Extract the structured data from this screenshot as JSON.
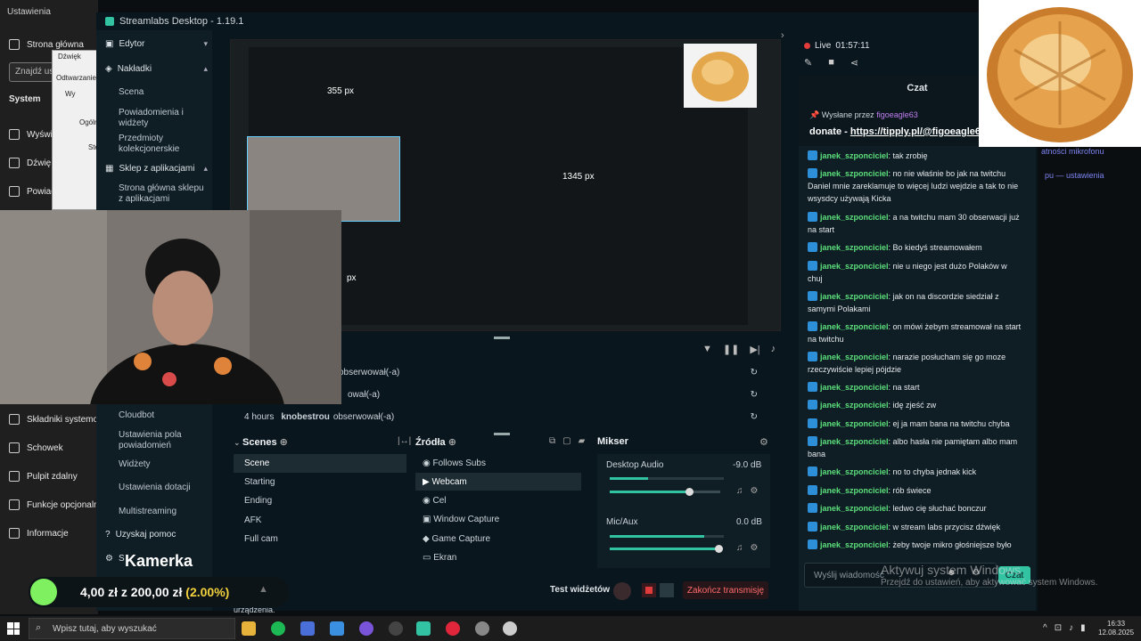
{
  "settings": {
    "title": "Ustawienia",
    "home": "Strona główna",
    "search_placeholder": "Znajdź ust",
    "system": "System",
    "display": "Wyświ",
    "sound": "Dźwię",
    "notifications": "Powiad",
    "components": "Składniki systemo",
    "clipboard": "Schowek",
    "remote": "Pulpit zdalny",
    "optional": "Funkcje opcjonalne",
    "info": "Informacje",
    "dialog_title": "Dźwięk",
    "dialog_tab": "Odtwarzanie",
    "dialog_item1": "Wy",
    "dialog_item2": "Ogóln",
    "dialog_item3": "Ste"
  },
  "window": {
    "title": "Streamlabs Desktop - 1.19.1"
  },
  "sidebar": {
    "editor": "Edytor",
    "overlays": "Nakładki",
    "scene": "Scena",
    "alerts": "Powiadomienia i widżety",
    "collectibles": "Przedmioty kolekcjonerskie",
    "app_store": "Sklep z aplikacjami",
    "store_home": "Strona główna sklepu z aplikacjami",
    "cloudbot": "Cloudbot",
    "alert_box": "Ustawienia pola powiadomień",
    "widgets": "Widżety",
    "donation_settings": "Ustawienia dotacji",
    "multistreaming": "Multistreaming",
    "help": "Uzyskaj pomoc",
    "s_prefix": "S"
  },
  "preview": {
    "label_355": "355 px",
    "label_1345": "1345 px",
    "label_px": "px"
  },
  "activity": [
    {
      "time": "",
      "user": "",
      "text": "obserwował(-a)"
    },
    {
      "time": "",
      "user": "",
      "text": "ował(-a)"
    },
    {
      "time": "4 hours",
      "user": "knobestrou",
      "text": "obserwował(-a)"
    }
  ],
  "scenes": {
    "title": "Scenes",
    "items": [
      "Scene",
      "Starting",
      "Ending",
      "AFK",
      "Full cam"
    ]
  },
  "sources": {
    "title": "Źródła",
    "items": [
      "Follows Subs",
      "Webcam",
      "Cel",
      "Window Capture",
      "Game Capture",
      "Ekran"
    ]
  },
  "mixer": {
    "title": "Mikser",
    "desktop_label": "Desktop Audio",
    "desktop_db": "-9.0 dB",
    "desktop_level": 0.72,
    "mic_label": "Mic/Aux",
    "mic_db": "0.0 dB",
    "mic_level": 0.98
  },
  "bottom": {
    "test_widgets": "Test widżetów",
    "end_stream": "Zakończ transmisję",
    "device_text": "urządzenia.",
    "kamerka": "Kamerka",
    "goal_amount": "4,00 zł z 200,00 zł",
    "goal_pct": "(2.00%)"
  },
  "live": {
    "label": "Live",
    "time": "01:57:11"
  },
  "chat": {
    "header": "Czat",
    "pinned_by": "Wysłane przez",
    "pinned_user": "figoeagle63",
    "pinned_prefix": "donate - ",
    "pinned_link": "https://tipply.pl/@figoeagle63",
    "input_placeholder": "Wyślij wiadomość",
    "send": "Czat",
    "messages": [
      {
        "u": "janek_szponciciel",
        "t": ": tak zrobię"
      },
      {
        "u": "janek_szponciciel",
        "t": ": no nie właśnie bo jak na twitchu Daniel mnie zareklamuje to więcej ludzi wejdzie a tak to nie wsysdcy używają Kicka"
      },
      {
        "u": "janek_szponciciel",
        "t": ": a na twitchu mam 30 obserwacji już na start"
      },
      {
        "u": "janek_szponciciel",
        "t": ": Bo kiedyś streamowałem"
      },
      {
        "u": "janek_szponciciel",
        "t": ": nie u niego jest dużo Polaków w chuj"
      },
      {
        "u": "janek_szponciciel",
        "t": ": jak on na discordzie siedział z samymi Polakami"
      },
      {
        "u": "janek_szponciciel",
        "t": ": on mówi żebym streamował na start na twitchu"
      },
      {
        "u": "janek_szponciciel",
        "t": ": narazie posłucham się go moze rzeczywiście lepiej pójdzie"
      },
      {
        "u": "janek_szponciciel",
        "t": ": na start"
      },
      {
        "u": "janek_szponciciel",
        "t": ": idę zjeść zw"
      },
      {
        "u": "janek_szponciciel",
        "t": ": ej ja mam bana na twitchu chyba"
      },
      {
        "u": "janek_szponciciel",
        "t": ": albo hasła nie pamiętam albo mam bana"
      },
      {
        "u": "janek_szponciciel",
        "t": ": no to chyba jednak kick"
      },
      {
        "u": "janek_szponciciel",
        "t": ": rób świece"
      },
      {
        "u": "janek_szponciciel",
        "t": ": ledwo cię słuchać bonczur"
      },
      {
        "u": "janek_szponciciel",
        "t": ": w stream labs przycisz dźwięk"
      },
      {
        "u": "janek_szponciciel",
        "t": ": żeby twoje mikro głośniejsze było"
      }
    ]
  },
  "behind": {
    "mic_text": "atności mikrofonu",
    "settings_link": "pu — ustawienia"
  },
  "watermark": {
    "line1": "Aktywuj system Windows",
    "line2": "Przejdź do ustawień, aby aktywować system Windows."
  },
  "taskbar": {
    "search": "Wpisz tutaj, aby wyszukać",
    "time": "16:33",
    "date": "12.08.2025"
  }
}
